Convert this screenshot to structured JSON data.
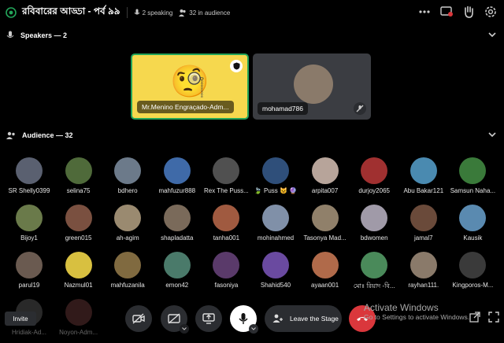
{
  "header": {
    "title": "রবিবারের আড্ডা - পর্ব ৯৯",
    "speaking": "2 speaking",
    "audience": "32 in audience"
  },
  "speakers": {
    "label": "Speakers — 2",
    "tiles": [
      {
        "name": "Mr.Menino Engraçado-Adm...",
        "color": "#f6d84e",
        "emoji": "🧐"
      },
      {
        "name": "mohamad786",
        "color": "#3b3d42"
      }
    ]
  },
  "audience": {
    "label": "Audience — 32",
    "members": [
      {
        "name": "SR Shelly0399",
        "color": "#5a6070"
      },
      {
        "name": "selina75",
        "color": "#4f6a3a"
      },
      {
        "name": "bdhero",
        "color": "#6c7a8a"
      },
      {
        "name": "mahfuzur888",
        "color": "#3f6aa8"
      },
      {
        "name": "Rex The Puss...",
        "color": "#505050"
      },
      {
        "name": "🍃 Puss 😺 🔮",
        "color": "#2f4f7a"
      },
      {
        "name": "arpita007",
        "color": "#b7a49a"
      },
      {
        "name": "durjoy2065",
        "color": "#a03030"
      },
      {
        "name": "Abu Bakar121",
        "color": "#4a8ab0"
      },
      {
        "name": "Samsun Naha...",
        "color": "#3a7a3a"
      },
      {
        "name": "Bijoy1",
        "color": "#6a7a4a"
      },
      {
        "name": "green015",
        "color": "#7a5040"
      },
      {
        "name": "ah-agim",
        "color": "#9a8a70"
      },
      {
        "name": "shapladatta",
        "color": "#7a6a5a"
      },
      {
        "name": "tanha001",
        "color": "#a05a40"
      },
      {
        "name": "mohinahmed",
        "color": "#8090a8"
      },
      {
        "name": "Tasonya Mad...",
        "color": "#90806a"
      },
      {
        "name": "bdwomen",
        "color": "#a09aa8"
      },
      {
        "name": "jamal7",
        "color": "#6a4a3a"
      },
      {
        "name": "Kausik",
        "color": "#5a8ab0"
      },
      {
        "name": "parul19",
        "color": "#6a5a50"
      },
      {
        "name": "Nazmul01",
        "color": "#d8c040"
      },
      {
        "name": "mahfuzanila",
        "color": "#806a40"
      },
      {
        "name": "emon42",
        "color": "#4a7a6a"
      },
      {
        "name": "fasoniya",
        "color": "#5a3a6a"
      },
      {
        "name": "Shahid540",
        "color": "#6a4aa0"
      },
      {
        "name": "ayaan001",
        "color": "#b06a4a"
      },
      {
        "name": "মোঃ রিয়াদ -বি...",
        "color": "#4a8a5a"
      },
      {
        "name": "rayhan111.",
        "color": "#8a7a6a"
      },
      {
        "name": "Kingporos-M...",
        "color": "#3a3a3a"
      },
      {
        "name": "Hridiak-Ad...",
        "color": "#4a4a4a"
      },
      {
        "name": "Noyon-Adm...",
        "color": "#5a3030"
      }
    ]
  },
  "controls": {
    "invite": "Invite",
    "leave": "Leave the Stage"
  },
  "watermark": {
    "line1": "Activate Windows",
    "line2": "Go to Settings to activate Windows."
  }
}
